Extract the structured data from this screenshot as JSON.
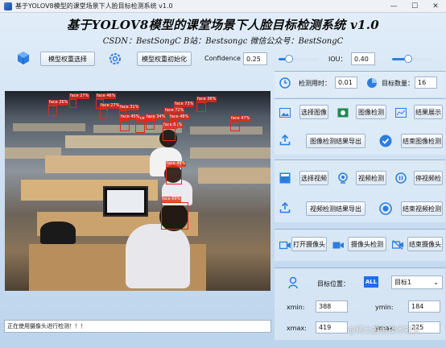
{
  "window": {
    "title": "基于YOLOV8模型的课堂场景下人脸目标检测系统 v1.0",
    "controls": {
      "minimize": "—",
      "maximize": "☐",
      "close": "✕"
    }
  },
  "header": {
    "title": "基于YOLOV8模型的课堂场景下人脸目标检测系统 v1.0",
    "subtitle": "CSDN：BestSongC   B站：Bestsongc   微信公众号：BestSongC"
  },
  "toolbar": {
    "model_select_label": "模型权重选择",
    "model_init_label": "模型权重初始化",
    "confidence_label": "Confidence",
    "confidence_value": "0.25",
    "confidence_level": 0.25,
    "iou_label": "IOU：",
    "iou_value": "0.40",
    "iou_level": 0.4
  },
  "stats": {
    "time_label": "检测用时：",
    "time_value": "0.01",
    "count_label": "目标数量：",
    "count_value": "16"
  },
  "image_section": {
    "select_label": "选择图像",
    "detect_label": "图像检测",
    "show_label": "结果展示",
    "export_label": "图像检测结果导出",
    "end_label": "结束图像检测"
  },
  "video_section": {
    "select_label": "选择视频",
    "detect_label": "视频检测",
    "pause_label": "停视频检",
    "export_label": "视频检测结果导出",
    "end_label": "结束视频检测"
  },
  "camera_section": {
    "open_label": "打开摄像头",
    "detect_label": "摄像头检测",
    "end_label": "结束摄像头"
  },
  "target": {
    "position_label": "目标位置：",
    "all_badge": "ALL",
    "select_value": "目标1",
    "xmin_label": "xmin:",
    "xmin_value": "388",
    "ymin_label": "ymin:",
    "ymin_value": "184",
    "xmax_label": "xmax:",
    "xmax_value": "419",
    "ymax_label": "ymax:",
    "ymax_value": "225"
  },
  "status": {
    "text": "正在使用摄像头进行检测！！！"
  },
  "watermark": "@稀土掘金技术社区",
  "detections": [
    {
      "label": "face 46%"
    },
    {
      "label": "face 26%"
    },
    {
      "label": "face 27%"
    },
    {
      "label": "face 27%"
    },
    {
      "label": "face 31%"
    },
    {
      "label": "face 36%"
    },
    {
      "label": "face 47%"
    },
    {
      "label": "face 74%"
    },
    {
      "label": "face 73%"
    },
    {
      "label": "face 72%"
    },
    {
      "label": "face 45%"
    },
    {
      "label": "face 61%"
    },
    {
      "label": "face 34%"
    },
    {
      "label": "face 48%"
    },
    {
      "label": "face 49%"
    },
    {
      "label": "face 69%"
    }
  ],
  "colors": {
    "accent": "#2f7fe6",
    "bbox": "#e02b1a",
    "panel_border": "#9ab5cf"
  }
}
